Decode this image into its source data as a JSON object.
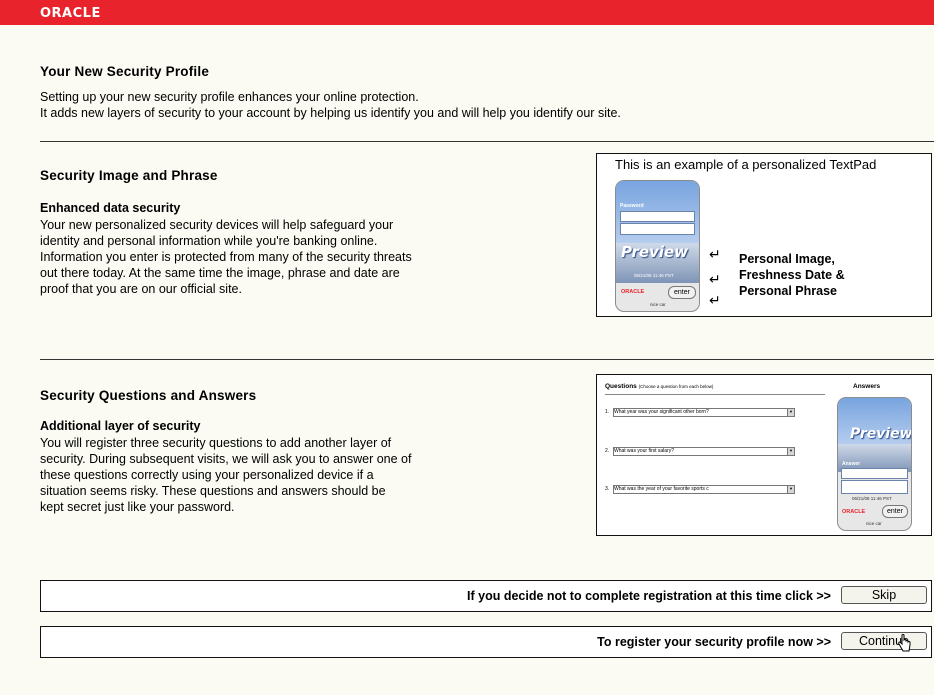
{
  "brand": {
    "logo": "ORACLE",
    "red": "#e8232b"
  },
  "header": {
    "title": "Your New Security Profile",
    "line1": "Setting up your new security profile enhances your online protection.",
    "line2": "It adds new layers of security to your account by helping us identify you and will help you identify our site."
  },
  "image_section": {
    "title": "Security Image and Phrase",
    "subtitle": "Enhanced data security",
    "lines": [
      "Your new personalized security devices will help safeguard your",
      "identity and personal information while you're banking online.",
      "Information you enter is protected from many of the security threats",
      "out there today. At the same time the image, phrase and date are",
      "proof that you are on our official site."
    ],
    "example_label": "This is an example of a personalized TextPad",
    "callout": [
      "Personal Image,",
      "Freshness Date &",
      "Personal Phrase"
    ],
    "device": {
      "field_label": "Password",
      "word": "Preview",
      "date": "06/21/08 11:46 PST",
      "brand": "ORACLE",
      "enter": "enter",
      "phrase": "nice car"
    }
  },
  "questions_section": {
    "title": "Security Questions and Answers",
    "subtitle": "Additional layer of security",
    "lines": [
      "You will register three security questions to add another layer of",
      "security. During subsequent visits, we will ask you to answer one of",
      "these questions correctly using your personalized device if a",
      "situation seems risky. These questions and answers should be",
      "kept secret just like your password."
    ],
    "questions_header": "Questions",
    "questions_hint": "(Choose a question from each below)",
    "answers_header": "Answers",
    "questions": [
      {
        "num": "1.",
        "text": "What year was your significant other born?"
      },
      {
        "num": "2.",
        "text": "What was your first salary?"
      },
      {
        "num": "3.",
        "text": "What was the year of your favorite sports c"
      }
    ],
    "device": {
      "word": "Preview",
      "field_label": "Answer",
      "date": "06/21/08 11:46 PST",
      "brand": "ORACLE",
      "enter": "enter",
      "phrase": "nice car"
    }
  },
  "skip_bar": {
    "text": "If you decide not to complete registration at this time click >>",
    "button": "Skip"
  },
  "continue_bar": {
    "text": "To register your security profile now >>",
    "button": "Continue"
  }
}
